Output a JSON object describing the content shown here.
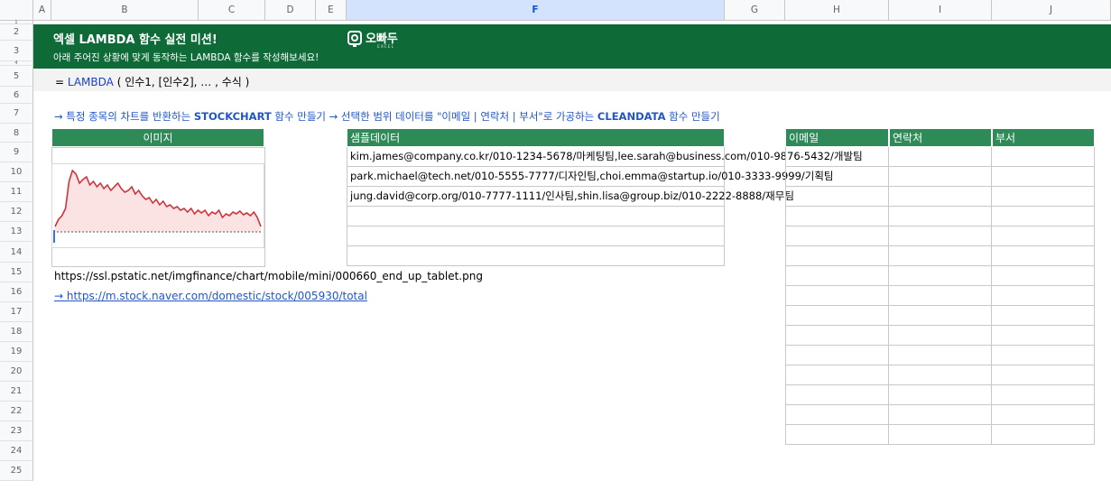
{
  "columns": [
    "A",
    "B",
    "C",
    "D",
    "E",
    "F",
    "G",
    "H",
    "I",
    "J"
  ],
  "selected_column": "F",
  "rows": [
    "1",
    "2",
    "3",
    "4",
    "5",
    "6",
    "7",
    "8",
    "9",
    "10",
    "11",
    "12",
    "13",
    "14",
    "15",
    "16",
    "17",
    "18",
    "19",
    "20",
    "21",
    "22",
    "23",
    "24",
    "25"
  ],
  "header": {
    "title": "엑셀 LAMBDA 함수 실전 미션!",
    "subtitle": "아래 주어진 상황에 맞게 동작하는 LAMBDA 함수를 작성해보세요!",
    "logo_text": "오빠두",
    "logo_sub": "EXCEL"
  },
  "formula": {
    "prefix": "=",
    "name": "LAMBDA",
    "args": " ( 인수1, [인수2], … , 수식 )"
  },
  "missions": {
    "m1_pre": "→ 특정 종목의 차트를 반환하는 ",
    "m1_key": "STOCKCHART",
    "m1_post": " 함수 만들기",
    "m2_pre": "→ 선택한 범위 데이터를 \"이메일 | 연락처 | 부서\"로 가공하는 ",
    "m2_key": "CLEANDATA",
    "m2_post": " 함수 만들기"
  },
  "image_section": {
    "header": "이미지",
    "url": "https://ssl.pstatic.net/imgfinance/chart/mobile/mini/000660_end_up_tablet.png",
    "link": "→ https://m.stock.naver.com/domestic/stock/005930/total"
  },
  "sample": {
    "header": "샘플데이터",
    "rows": [
      "kim.james@company.co.kr/010-1234-5678/마케팅팀,lee.sarah@business.com/010-9876-5432/개발팀",
      "park.michael@tech.net/010-5555-7777/디자인팀,choi.emma@startup.io/010-3333-9999/기획팀",
      "jung.david@corp.org/010-7777-1111/인사팀,shin.lisa@group.biz/010-2222-8888/재무팀",
      "",
      "",
      ""
    ]
  },
  "result_table": {
    "headers": [
      "이메일",
      "연락처",
      "부서"
    ]
  },
  "colors": {
    "banner": "#0e6b38",
    "table_header": "#2e8b57",
    "accent_blue": "#1a3fd1",
    "chart_line": "#d0323c"
  }
}
